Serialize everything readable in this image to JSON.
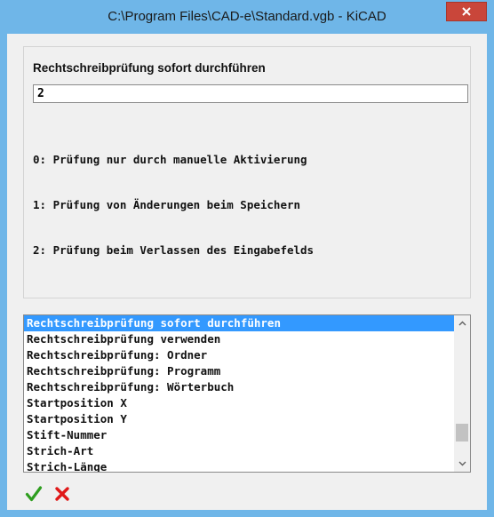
{
  "window": {
    "title": "C:\\Program Files\\CAD-e\\Standard.vgb - KiCAD"
  },
  "setting": {
    "heading": "Rechtschreibprüfung sofort durchführen",
    "value": "2",
    "help": [
      "0: Prüfung nur durch manuelle Aktivierung",
      "1: Prüfung von Änderungen beim Speichern",
      "2: Prüfung beim Verlassen des Eingabefelds"
    ]
  },
  "list": {
    "items": [
      "Rechtschreibprüfung sofort durchführen",
      "Rechtschreibprüfung verwenden",
      "Rechtschreibprüfung: Ordner",
      "Rechtschreibprüfung: Programm",
      "Rechtschreibprüfung: Wörterbuch",
      "Startposition X",
      "Startposition Y",
      "Stift-Nummer",
      "Strich-Art",
      "Strich-Länge"
    ],
    "selected_index": 0
  },
  "icons": {
    "close": "close-icon",
    "ok": "checkmark-icon",
    "cancel": "cross-icon",
    "scroll_up": "chevron-up-icon",
    "scroll_down": "chevron-down-icon"
  },
  "colors": {
    "frame": "#6fb6e8",
    "close": "#c9463a",
    "selection": "#3399ff",
    "ok": "#2e9e1f",
    "cancel": "#e01818"
  }
}
